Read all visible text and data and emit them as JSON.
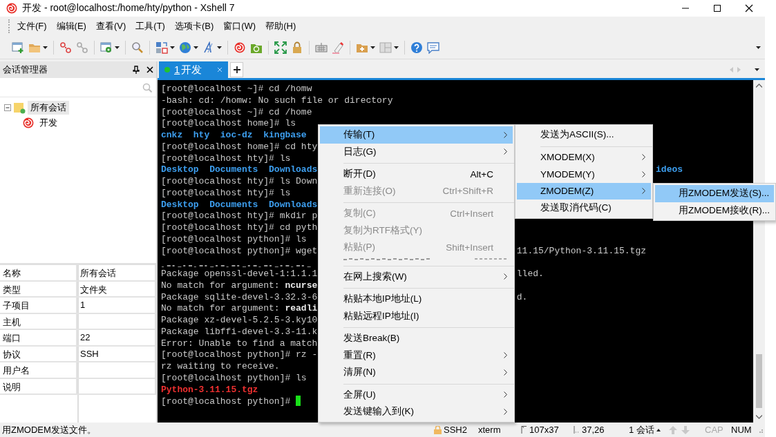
{
  "window": {
    "title": "开发 - root@localhost:/home/hty/python - Xshell 7"
  },
  "menu_bar": [
    "文件(F)",
    "编辑(E)",
    "查看(V)",
    "工具(T)",
    "选项卡(B)",
    "窗口(W)",
    "帮助(H)"
  ],
  "session_manager": {
    "title": "会话管理器",
    "tree": [
      {
        "label": "所有会话",
        "kind": "folder",
        "expanded": true,
        "selected": true,
        "children": [
          {
            "label": "开发",
            "kind": "session",
            "selected": false
          }
        ]
      }
    ],
    "properties": [
      {
        "name": "名称",
        "value": "所有会话"
      },
      {
        "name": "类型",
        "value": "文件夹"
      },
      {
        "name": "子项目",
        "value": "1"
      },
      {
        "name": "主机"
      },
      {
        "name": "端口",
        "value": "22"
      },
      {
        "name": "协议",
        "value": "SSH"
      },
      {
        "name": "用户名"
      },
      {
        "name": "说明"
      }
    ]
  },
  "tabs": [
    {
      "number": "1",
      "label": "开发",
      "selected": true,
      "connected": true
    }
  ],
  "terminal": {
    "cursor_visible": true,
    "lines": [
      {
        "kind": "plain",
        "text": "[root@localhost ~]# cd /homw"
      },
      {
        "kind": "plain",
        "text": "-bash: cd: /homw: No such file or directory"
      },
      {
        "kind": "plain",
        "text": "[root@localhost ~]# cd /home"
      },
      {
        "kind": "plain",
        "text": "[root@localhost home]# ls"
      },
      {
        "kind": "dirs",
        "text": "cnkz  hty  ioc-dz  kingbase"
      },
      {
        "kind": "plain",
        "text": "[root@localhost home]# cd hty"
      },
      {
        "kind": "plain",
        "text": "[root@localhost hty]# ls"
      },
      {
        "kind": "dirs",
        "text": "Desktop  Documents  Downloads",
        "tail": "ideos"
      },
      {
        "kind": "plain",
        "text": "[root@localhost hty]# ls Down"
      },
      {
        "kind": "plain",
        "text": "[root@localhost hty]# ls"
      },
      {
        "kind": "dirs",
        "text": "Desktop  Documents  Downloads"
      },
      {
        "kind": "plain",
        "text": "[root@localhost hty]# mkdir p"
      },
      {
        "kind": "plain",
        "text": "[root@localhost hty]# cd pyth"
      },
      {
        "kind": "plain",
        "text": "[root@localhost python]# ls"
      },
      {
        "kind": "plain",
        "text": "[root@localhost python]# wget",
        "tail": "11.15/Python-3.11.15.tgz"
      },
      {
        "kind": "garbled"
      },
      {
        "kind": "plain",
        "text": "Package openssl-devel-1:1.1.1",
        "tail": "lled."
      },
      {
        "kind": "plain",
        "text": "No match for argument: **ncurse**"
      },
      {
        "kind": "plain",
        "text": "Package sqlite-devel-3.32.3-6",
        "tail": "d."
      },
      {
        "kind": "plain",
        "text": "No match for argument: **readli**"
      },
      {
        "kind": "plain",
        "text": "Package xz-devel-5.2.5-3.ky10"
      },
      {
        "kind": "plain",
        "text": "Package libffi-devel-3.3-11.k"
      },
      {
        "kind": "plain",
        "text": "Error: Unable to find a match"
      },
      {
        "kind": "plain",
        "text": "[root@localhost python]# rz -"
      },
      {
        "kind": "plain",
        "text": "rz waiting to receive."
      },
      {
        "kind": "plain",
        "text": "[root@localhost python]# ls"
      },
      {
        "kind": "archive",
        "text": "Python-3.11.15.tgz"
      },
      {
        "kind": "plain",
        "text": "[root@localhost python]#"
      }
    ]
  },
  "context_menu": {
    "items": [
      {
        "kind": "item",
        "label": "传输(T)",
        "submenu": true,
        "selected": true,
        "disabled": false
      },
      {
        "kind": "item",
        "label": "日志(G)",
        "submenu": true,
        "selected": false,
        "disabled": false
      },
      {
        "kind": "separator"
      },
      {
        "kind": "item",
        "label": "断开(D)",
        "shortcut": "Alt+C",
        "submenu": false,
        "selected": false,
        "disabled": false
      },
      {
        "kind": "item",
        "label": "重新连接(O)",
        "shortcut": "Ctrl+Shift+R",
        "submenu": false,
        "selected": false,
        "disabled": true
      },
      {
        "kind": "separator"
      },
      {
        "kind": "item",
        "label": "复制(C)",
        "shortcut": "Ctrl+Insert",
        "submenu": false,
        "selected": false,
        "disabled": true
      },
      {
        "kind": "item",
        "label": "复制为RTF格式(Y)",
        "submenu": false,
        "selected": false,
        "disabled": true
      },
      {
        "kind": "item",
        "label": "粘贴(P)",
        "shortcut": "Shift+Insert",
        "submenu": false,
        "selected": false,
        "disabled": true
      },
      {
        "kind": "garbled"
      },
      {
        "kind": "separator"
      },
      {
        "kind": "item",
        "label": "在网上搜索(W)",
        "submenu": true,
        "selected": false,
        "disabled": false
      },
      {
        "kind": "separator"
      },
      {
        "kind": "item",
        "label": "粘贴本地IP地址(L)",
        "submenu": false,
        "selected": false,
        "disabled": false
      },
      {
        "kind": "item",
        "label": "粘贴远程IP地址(I)",
        "submenu": false,
        "selected": false,
        "disabled": false
      },
      {
        "kind": "separator"
      },
      {
        "kind": "item",
        "label": "发送Break(B)",
        "submenu": false,
        "selected": false,
        "disabled": false
      },
      {
        "kind": "item",
        "label": "重置(R)",
        "submenu": true,
        "selected": false,
        "disabled": false
      },
      {
        "kind": "item",
        "label": "清屏(N)",
        "submenu": true,
        "selected": false,
        "disabled": false
      },
      {
        "kind": "separator"
      },
      {
        "kind": "item",
        "label": "全屏(U)",
        "submenu": true,
        "selected": false,
        "disabled": false
      },
      {
        "kind": "item",
        "label": "发送键输入到(K)",
        "submenu": true,
        "selected": false,
        "disabled": false
      }
    ]
  },
  "transfer_submenu": {
    "items": [
      {
        "kind": "item",
        "label": "发送为ASCII(S)...",
        "submenu": false,
        "selected": false,
        "disabled": false
      },
      {
        "kind": "separator"
      },
      {
        "kind": "item",
        "label": "XMODEM(X)",
        "submenu": true,
        "selected": false,
        "disabled": false
      },
      {
        "kind": "item",
        "label": "YMODEM(Y)",
        "submenu": true,
        "selected": false,
        "disabled": false
      },
      {
        "kind": "item",
        "label": "ZMODEM(Z)",
        "submenu": true,
        "selected": true,
        "disabled": false
      },
      {
        "kind": "item",
        "label": "发送取消代码(C)",
        "submenu": false,
        "selected": false,
        "disabled": false
      }
    ]
  },
  "zmodem_submenu": {
    "items": [
      {
        "kind": "item",
        "label": "用ZMODEM发送(S)...",
        "selected": true,
        "disabled": false
      },
      {
        "kind": "item",
        "label": "用ZMODEM接收(R)...",
        "selected": false,
        "disabled": false
      }
    ]
  },
  "status_bar": {
    "message": "用ZMODEM发送文件。",
    "protocol": "SSH2",
    "terminal_type": "xterm",
    "size": "107x37",
    "cursor": "37,26",
    "sessions": "1 会话",
    "indicators": [
      {
        "label": "CAP",
        "on": false
      },
      {
        "label": "NUM",
        "on": true
      }
    ]
  }
}
